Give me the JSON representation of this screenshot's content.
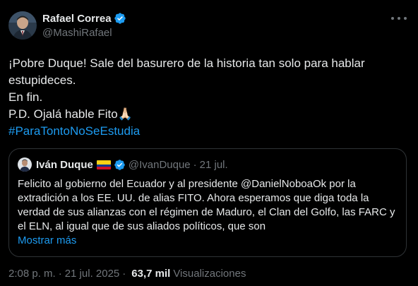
{
  "author": {
    "display_name": "Rafael Correa",
    "handle": "@MashiRafael",
    "verified": true,
    "avatar_icon": "profile-photo"
  },
  "tweet": {
    "lines": [
      "¡Pobre Duque! Sale del basurero de la historia tan solo para hablar",
      "estupideces.",
      "En fin.",
      "P.D. Ojalá hable Fito🙏🏻"
    ],
    "hashtag": "#ParaTontoNoSeEstudia"
  },
  "quoted": {
    "display_name": "Iván Duque",
    "flag_icon": "colombia-flag-icon",
    "verified": true,
    "handle": "@IvanDuque",
    "dot": "·",
    "date": "21 jul.",
    "lines": [
      "Felicito al gobierno del Ecuador y al presidente @DanielNoboaOk por la",
      "extradición a los EE. UU. de alias FITO. Ahora esperamos que diga toda la",
      "verdad de sus alianzas con el régimen de Maduro, el Clan del Golfo, las FARC y",
      "el ELN, al igual que de sus aliados políticos, que son"
    ],
    "show_more": "Mostrar más"
  },
  "meta": {
    "time": "2:08 p. m.",
    "dot1": "·",
    "date": "21 jul. 2025",
    "dot2": "·",
    "views_count": "63,7 mil",
    "views_label": "Visualizaciones"
  },
  "colors": {
    "background": "#000000",
    "text": "#e7e9ea",
    "secondary": "#71767b",
    "accent": "#1d9bf0",
    "border": "#2f3336"
  }
}
